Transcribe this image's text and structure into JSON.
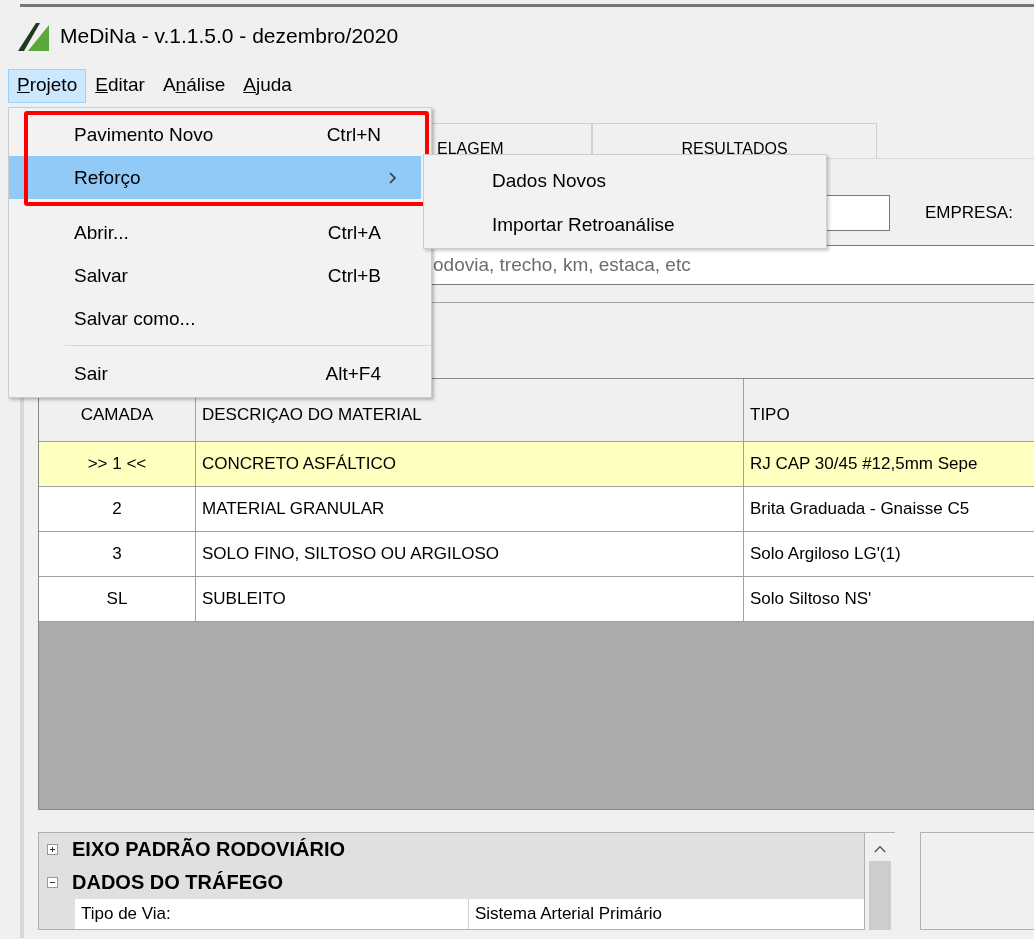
{
  "window": {
    "title": "MeDiNa - v.1.1.5.0 - dezembro/2020"
  },
  "menubar": [
    {
      "key": "P",
      "after": "rojeto",
      "selected": true
    },
    {
      "key": "E",
      "after": "ditar",
      "selected": false
    },
    {
      "before": "A",
      "key": "n",
      "after": "álise",
      "selected": false
    },
    {
      "key": "A",
      "after": "juda",
      "selected": false
    }
  ],
  "menu": {
    "items": [
      {
        "kind": "item",
        "label": "Pavimento Novo",
        "shortcut": "Ctrl+N",
        "submenu": false,
        "selected": false,
        "framed": true
      },
      {
        "kind": "item",
        "label": "Reforço",
        "submenu": true,
        "selected": true,
        "framed": true
      },
      {
        "kind": "separator"
      },
      {
        "kind": "item",
        "label": "Abrir...",
        "shortcut": "Ctrl+A",
        "submenu": false,
        "selected": false,
        "framed": false
      },
      {
        "kind": "item",
        "label": "Salvar",
        "shortcut": "Ctrl+B",
        "submenu": false,
        "selected": false,
        "framed": false
      },
      {
        "kind": "item",
        "label": "Salvar como...",
        "submenu": false,
        "selected": false,
        "framed": false
      },
      {
        "kind": "separator"
      },
      {
        "kind": "item",
        "label": "Sair",
        "shortcut": "Alt+F4",
        "submenu": false,
        "selected": false,
        "framed": false
      }
    ],
    "submenu": [
      {
        "label": "Dados Novos"
      },
      {
        "label": "Importar Retroanálise"
      }
    ]
  },
  "tabs": [
    {
      "label": "ELAGEM",
      "selected": false
    },
    {
      "label": "RESULTADOS",
      "selected": false
    }
  ],
  "form": {
    "company_label": "EMPRESA:",
    "location_placeholder": "odovia, trecho, km, estaca, etc"
  },
  "table": {
    "columns": [
      "CAMADA",
      "DESCRIÇAO DO MATERIAL",
      "TIPO"
    ],
    "rows": [
      {
        "cells": [
          ">> 1 <<",
          "CONCRETO ASFÁLTICO",
          "RJ CAP 30/45 #12,5mm Sepe"
        ],
        "selected": true
      },
      {
        "cells": [
          "2",
          "MATERIAL GRANULAR",
          "Brita Graduada - Gnaisse C5"
        ],
        "selected": false
      },
      {
        "cells": [
          "3",
          "SOLO FINO, SILTOSO OU ARGILOSO",
          "Solo Argiloso LG'(1)"
        ],
        "selected": false
      },
      {
        "cells": [
          "SL",
          "SUBLEITO",
          "Solo Siltoso NS'"
        ],
        "selected": false
      }
    ]
  },
  "properties": {
    "categories": [
      {
        "label": "EIXO PADRÃO RODOVIÁRIO",
        "expanded": false
      },
      {
        "label": "DADOS DO TRÁFEGO",
        "expanded": true,
        "children": [
          {
            "name": "Tipo de Via:",
            "value": "Sistema Arterial Primário"
          }
        ]
      }
    ]
  }
}
